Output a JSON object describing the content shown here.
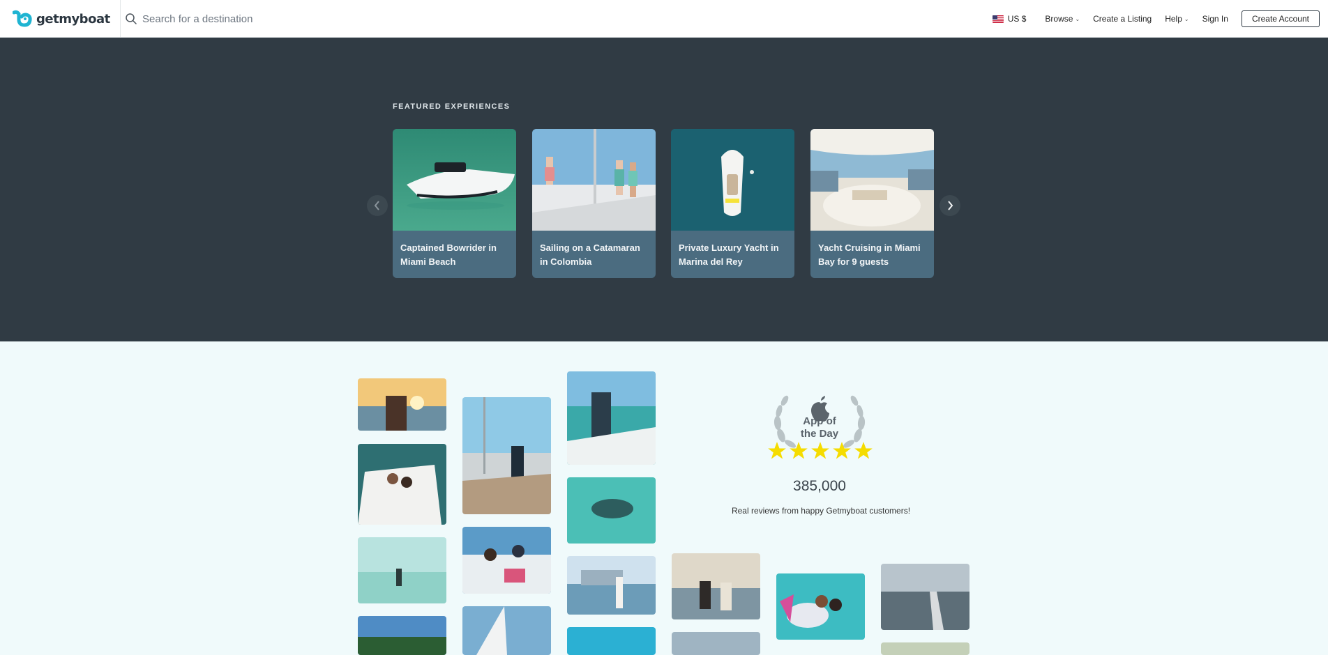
{
  "header": {
    "logo_text": "getmyboat",
    "search_placeholder": "Search for a destination",
    "currency": "US $",
    "browse": "Browse",
    "create_listing": "Create a Listing",
    "help": "Help",
    "sign_in": "Sign In",
    "create_account": "Create Account"
  },
  "featured": {
    "title": "FEATURED EXPERIENCES",
    "cards": [
      {
        "title": "Captained Bowrider in Miami Beach"
      },
      {
        "title": "Sailing on a Catamaran in Colombia"
      },
      {
        "title": "Private Luxury Yacht in Marina del Rey"
      },
      {
        "title": "Yacht Cruising in Miami Bay for 9 guests"
      }
    ]
  },
  "reviews": {
    "award_line1": "App of",
    "award_line2": "the Day",
    "rating_stars": 5,
    "count": "385,000",
    "caption": "Real reviews from happy Getmyboat customers!"
  },
  "colors": {
    "dark_band": "#303b44",
    "card_bg": "#4b6c80",
    "star": "#f5dc00",
    "page_bg": "#f0fafb"
  }
}
